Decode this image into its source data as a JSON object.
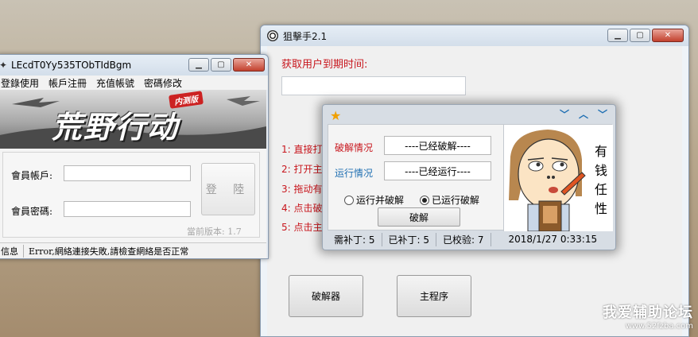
{
  "main_window": {
    "title": "狙擊手2.1",
    "expire_label": "获取用户到期时间:",
    "expire_value": "",
    "steps": [
      "1: 直接打",
      "2: 打开主",
      "3: 拖动有",
      "4: 点击破",
      "5: 点击主"
    ],
    "buttons": {
      "cracker": "破解器",
      "main_program": "主程序"
    }
  },
  "popup": {
    "crack_label": "破解情况",
    "crack_value": "----已经破解----",
    "run_label": "运行情况",
    "run_value": "----已经运行----",
    "radio_run_crack": "运行并破解",
    "radio_run_cracked": "已运行破解",
    "crack_button": "破解",
    "cartoon_text": [
      "有",
      "钱",
      "任",
      "性"
    ],
    "status": {
      "need_patch": "需补丁: 5",
      "patched": "已补丁: 5",
      "verified": "已校验: 7",
      "datetime": "2018/1/27 0:33:15"
    }
  },
  "login_window": {
    "title": "LEcdT0Yy535TObTIdBgm",
    "menu": [
      "登錄使用",
      "帳戶注冊",
      "充值帳號",
      "密碼修改"
    ],
    "banner_title": "荒野行动",
    "banner_tag": "内测版",
    "account_label": "會員帳戶:",
    "password_label": "會員密碼:",
    "login_button": "登 陸",
    "version": "當前版本: 1.7",
    "status_left": "信息",
    "status_msg": "Error,網絡連接失敗,請檢查網絡是否正常"
  },
  "watermark": {
    "line1": "我爱辅助论坛",
    "line2": "www.52fzba.com"
  },
  "colors": {
    "red_text": "#c8161d",
    "link_blue": "#1f6fb2",
    "icon_star": "#f0a000"
  }
}
